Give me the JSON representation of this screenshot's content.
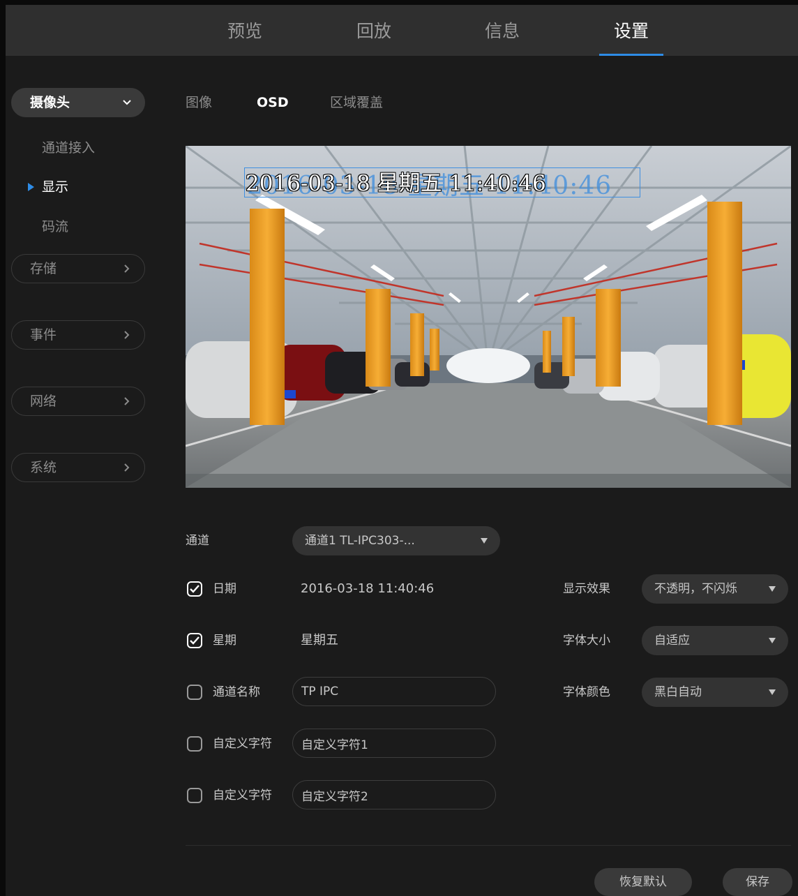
{
  "topnav": {
    "tabs": [
      {
        "label": "预览"
      },
      {
        "label": "回放"
      },
      {
        "label": "信息"
      },
      {
        "label": "设置"
      }
    ],
    "active_index": 3
  },
  "sidebar": {
    "camera_group": {
      "label": "摄像头"
    },
    "camera_items": [
      {
        "label": "通道接入"
      },
      {
        "label": "显示"
      },
      {
        "label": "码流"
      }
    ],
    "groups": [
      {
        "label": "存储"
      },
      {
        "label": "事件"
      },
      {
        "label": "网络"
      },
      {
        "label": "系统"
      }
    ]
  },
  "subtabs": [
    {
      "label": "图像"
    },
    {
      "label": "OSD"
    },
    {
      "label": "区域覆盖"
    }
  ],
  "preview": {
    "osd_text": "2016-03-18 星期五 11:40:46",
    "osd_ghost": "2016-03-18 星期五 11:40:46"
  },
  "form": {
    "channel": {
      "label": "通道",
      "value": "通道1 TL-IPC303-..."
    },
    "date": {
      "label": "日期",
      "value": "2016-03-18 11:40:46",
      "checked": true
    },
    "weekday": {
      "label": "星期",
      "value": "星期五",
      "checked": true
    },
    "channel_name": {
      "label": "通道名称",
      "value": "TP IPC",
      "checked": false
    },
    "custom1": {
      "label": "自定义字符",
      "value": "自定义字符1",
      "checked": false
    },
    "custom2": {
      "label": "自定义字符",
      "value": "自定义字符2",
      "checked": false
    },
    "display_effect": {
      "label": "显示效果",
      "value": "不透明，不闪烁"
    },
    "font_size": {
      "label": "字体大小",
      "value": "自适应"
    },
    "font_color": {
      "label": "字体颜色",
      "value": "黑白自动"
    }
  },
  "buttons": {
    "restore": "恢复默认",
    "save": "保存"
  },
  "colors": {
    "accent": "#2e8ce6",
    "background": "#1b1b1b",
    "nav_bar": "#2f2f2f"
  }
}
